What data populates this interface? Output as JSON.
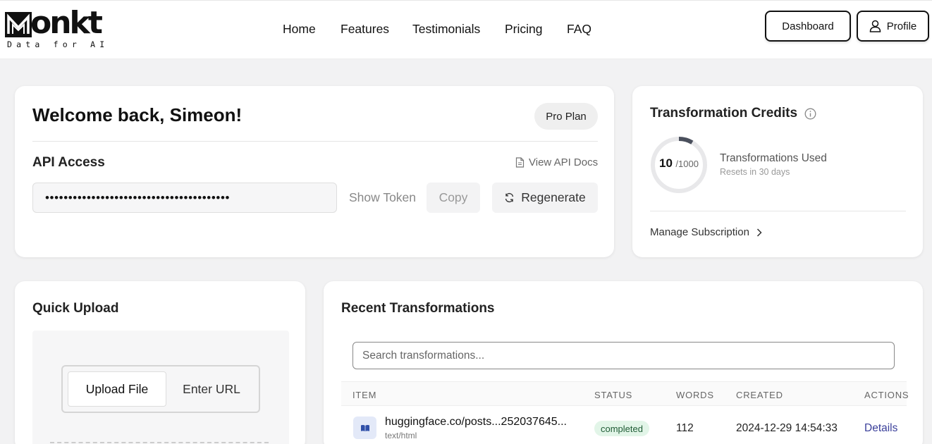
{
  "header": {
    "logo_word": "onkt",
    "logo_tagline": "Data for AI",
    "nav": [
      "Home",
      "Features",
      "Testimonials",
      "Pricing",
      "FAQ"
    ],
    "dashboard_label": "Dashboard",
    "profile_label": "Profile"
  },
  "welcome": {
    "title": "Welcome back, Simeon!",
    "plan_badge": "Pro Plan",
    "api_title": "API Access",
    "docs_link": "View API Docs",
    "token_masked": "••••••••••••••••••••••••••••••••••••••••",
    "show_token": "Show Token",
    "copy": "Copy",
    "regenerate": "Regenerate"
  },
  "credits": {
    "title": "Transformation Credits",
    "used": "10",
    "total": "/1000",
    "used_fraction": 0.01,
    "used_label": "Transformations Used",
    "reset_label": "Resets in 30 days",
    "manage_label": "Manage Subscription",
    "ring_color": "#4a4f5c",
    "ring_track_color": "#e8e8ea"
  },
  "quick_upload": {
    "title": "Quick Upload",
    "tab_upload": "Upload File",
    "tab_url": "Enter URL"
  },
  "recent": {
    "title": "Recent Transformations",
    "search_placeholder": "Search transformations...",
    "columns": [
      "ITEM",
      "STATUS",
      "WORDS",
      "CREATED",
      "ACTIONS"
    ],
    "rows": [
      {
        "icon": "book-icon",
        "name": "huggingface.co/posts...252037645...",
        "type": "text/html",
        "status": "completed",
        "words": "112",
        "created": "2024-12-29 14:54:33",
        "action": "Details"
      }
    ]
  }
}
